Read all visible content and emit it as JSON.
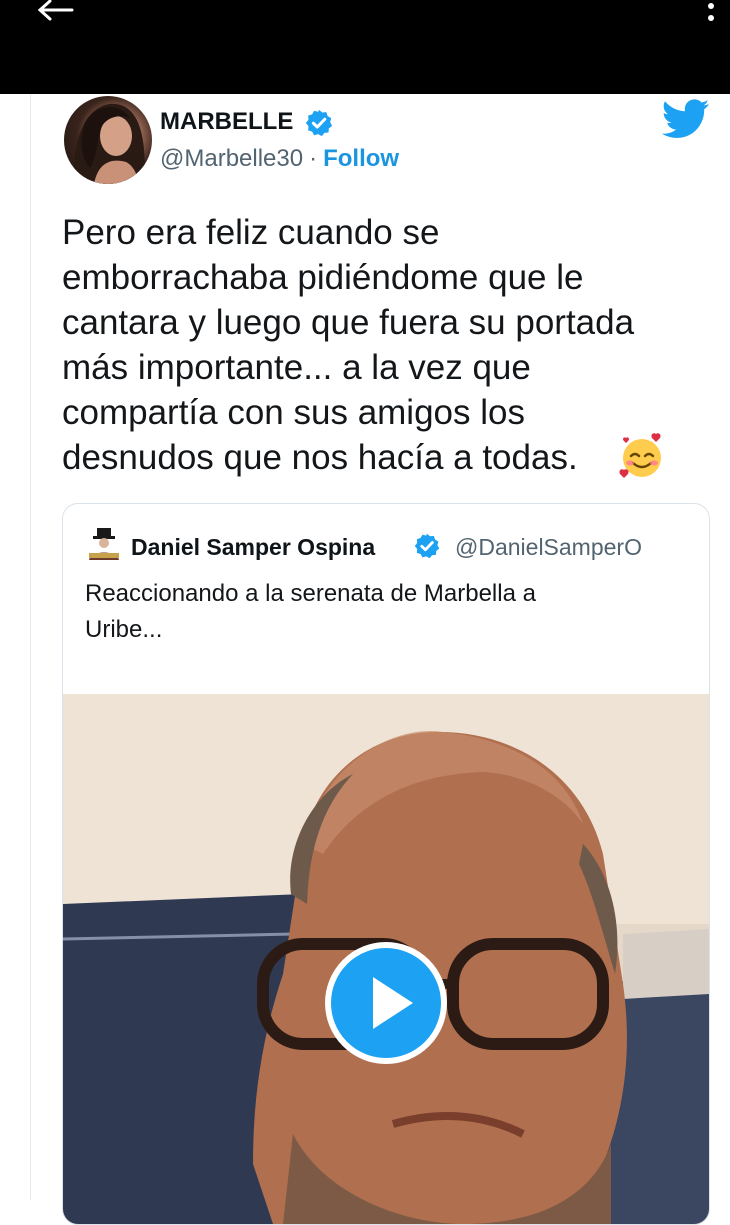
{
  "tweet": {
    "display_name": "MARBELLE",
    "handle": "@Marbelle30",
    "separator": "·",
    "follow_label": "Follow",
    "text_lines": [
      "Pero era feliz cuando se",
      "emborrachaba pidiéndome que le",
      "cantara y luego que fuera su portada",
      "más importante... a la vez que",
      "compartía con sus amigos los",
      "desnudos que nos hacía a todas."
    ]
  },
  "quoted": {
    "display_name": "Daniel Samper Ospina",
    "handle": "@DanielSamperO",
    "text_lines": [
      "Reaccionando a la serenata de Marbella a",
      "Uribe..."
    ]
  },
  "colors": {
    "accent": "#1da1f2",
    "follow": "#1b95e0",
    "topbar": "#000000"
  },
  "icons": {
    "back": "arrow-left-icon",
    "more": "vertical-dots-icon",
    "verified": "verified-badge-icon",
    "brand": "twitter-bird-icon",
    "emoji": "smiling-face-with-hearts-icon",
    "play": "play-icon"
  }
}
